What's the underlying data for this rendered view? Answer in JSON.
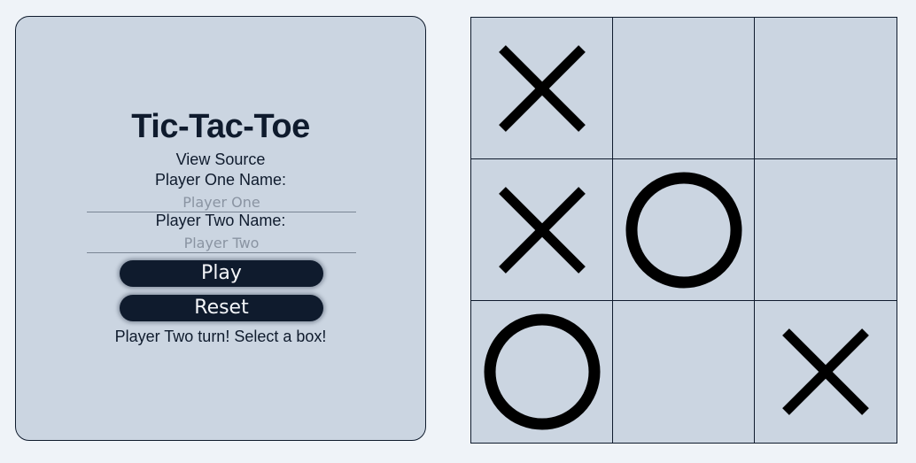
{
  "game": {
    "title": "Tic-Tac-Toe",
    "view_source_label": "View Source",
    "player_one_label": "Player One Name:",
    "player_one_placeholder": "Player One",
    "player_two_label": "Player Two Name:",
    "player_two_placeholder": "Player Two",
    "play_label": "Play",
    "reset_label": "Reset",
    "status": "Player Two turn! Select a box!"
  },
  "board": {
    "cells": [
      "X",
      "",
      "",
      "X",
      "O",
      "",
      "O",
      "",
      "X"
    ]
  }
}
